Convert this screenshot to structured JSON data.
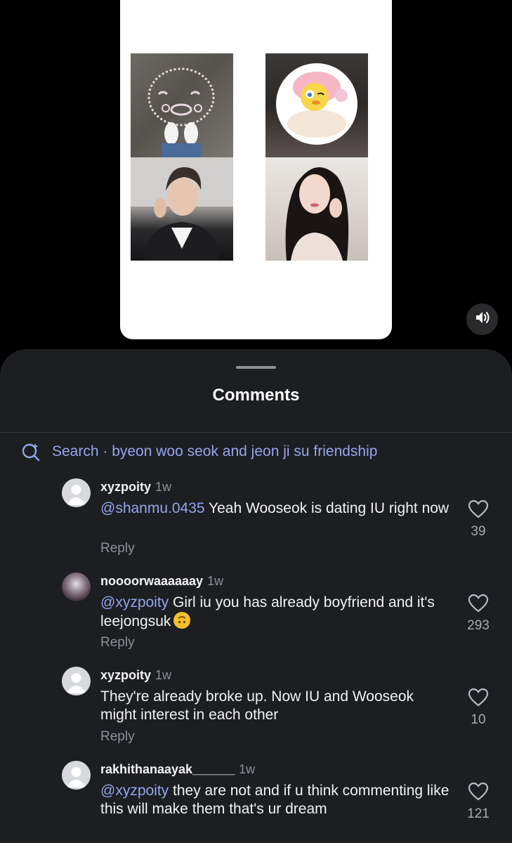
{
  "sheet": {
    "title": "Comments",
    "search_text": "Search · byeon woo seok and jeon ji su friendship"
  },
  "reply_label": "Reply",
  "comments": [
    {
      "username": "xyzpoity",
      "time": "1w",
      "mention": "@shanmu.0435",
      "text": " Yeah Wooseok is dating IU right now",
      "likes": "39"
    },
    {
      "username": "noooorwaaaaaay",
      "time": "1w",
      "mention": "@xyzpoity",
      "text": " Girl iu you has already boyfriend and it's leejongsuk",
      "emoji": "upside-down-face-emoji",
      "likes": "293"
    },
    {
      "username": "xyzpoity",
      "time": "1w",
      "mention": "",
      "text": "They're already broke up. Now IU and Wooseok might interest in each other",
      "likes": "10"
    },
    {
      "username": "rakhithanaayak______",
      "time": "1w",
      "mention": "@xyzpoity",
      "text": " they are not and if u think commenting like this will make them that's ur dream",
      "likes": "121"
    }
  ],
  "colors": {
    "sheet_bg": "#1c1e21",
    "mention": "#94a5ee",
    "muted": "#8d9096"
  }
}
